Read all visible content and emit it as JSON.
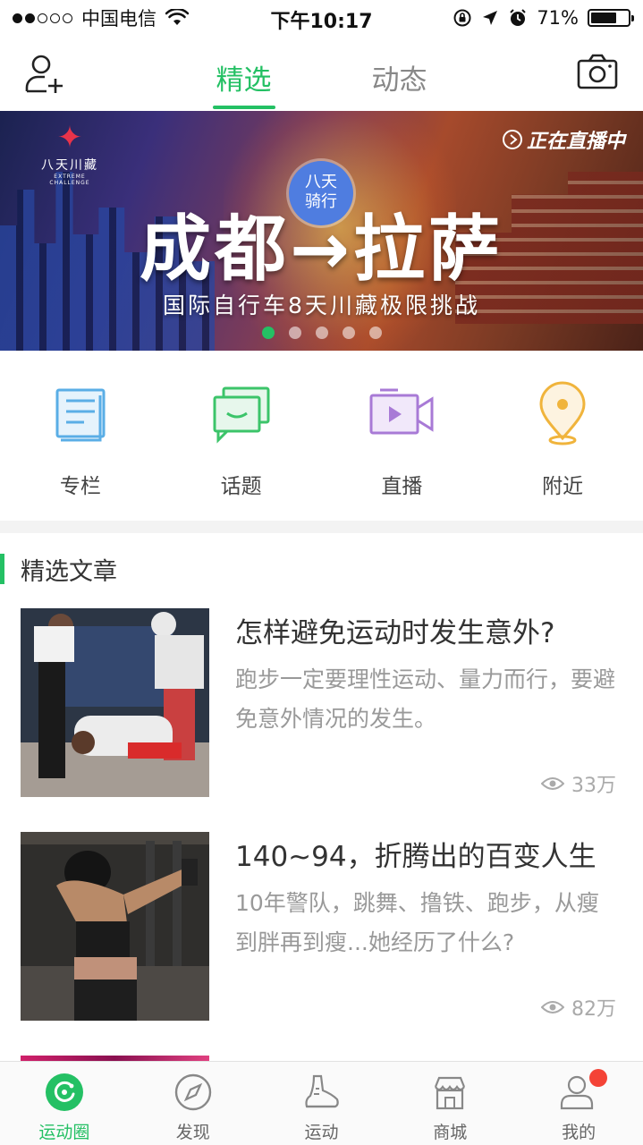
{
  "status_bar": {
    "carrier": "中国电信",
    "time": "下午10:17",
    "battery": "71%",
    "battery_level": 0.71,
    "signal_bars": 2
  },
  "header": {
    "tabs": [
      {
        "label": "精选",
        "active": true
      },
      {
        "label": "动态",
        "active": false
      }
    ]
  },
  "banner": {
    "logo_name": "八天川藏",
    "logo_sub": "EXTREME CHALLENGE",
    "live_label": "正在直播中",
    "badge_line1": "八天",
    "badge_line2": "骑行",
    "title": "成都→拉萨",
    "subtitle": "国际自行车8天川藏极限挑战",
    "slide_count": 5,
    "active_slide": 1
  },
  "quick_menu": [
    {
      "label": "专栏",
      "icon": "column-icon"
    },
    {
      "label": "话题",
      "icon": "topic-icon"
    },
    {
      "label": "直播",
      "icon": "live-video-icon"
    },
    {
      "label": "附近",
      "icon": "location-pin-icon"
    }
  ],
  "section": {
    "title": "精选文章"
  },
  "articles": [
    {
      "title": "怎样避免运动时发生意外?",
      "desc": "跑步一定要理性运动、量力而行，要避免意外情况的发生。",
      "views": "33万"
    },
    {
      "title": "140~94，折腾出的百变人生",
      "desc": "10年警队，跳舞、撸铁、跑步，从瘦到胖再到瘦...她经历了什么?",
      "views": "82万"
    }
  ],
  "tabbar": [
    {
      "label": "运动圈",
      "active": true
    },
    {
      "label": "发现",
      "active": false
    },
    {
      "label": "运动",
      "active": false
    },
    {
      "label": "商城",
      "active": false
    },
    {
      "label": "我的",
      "active": false,
      "badge": true
    }
  ],
  "colors": {
    "accent": "#24c064",
    "badge_red": "#f44336",
    "topic_green": "#3cc46a",
    "column_blue": "#5aaee6",
    "live_purple": "#a87ad6",
    "nearby_orange": "#f0b43c"
  }
}
